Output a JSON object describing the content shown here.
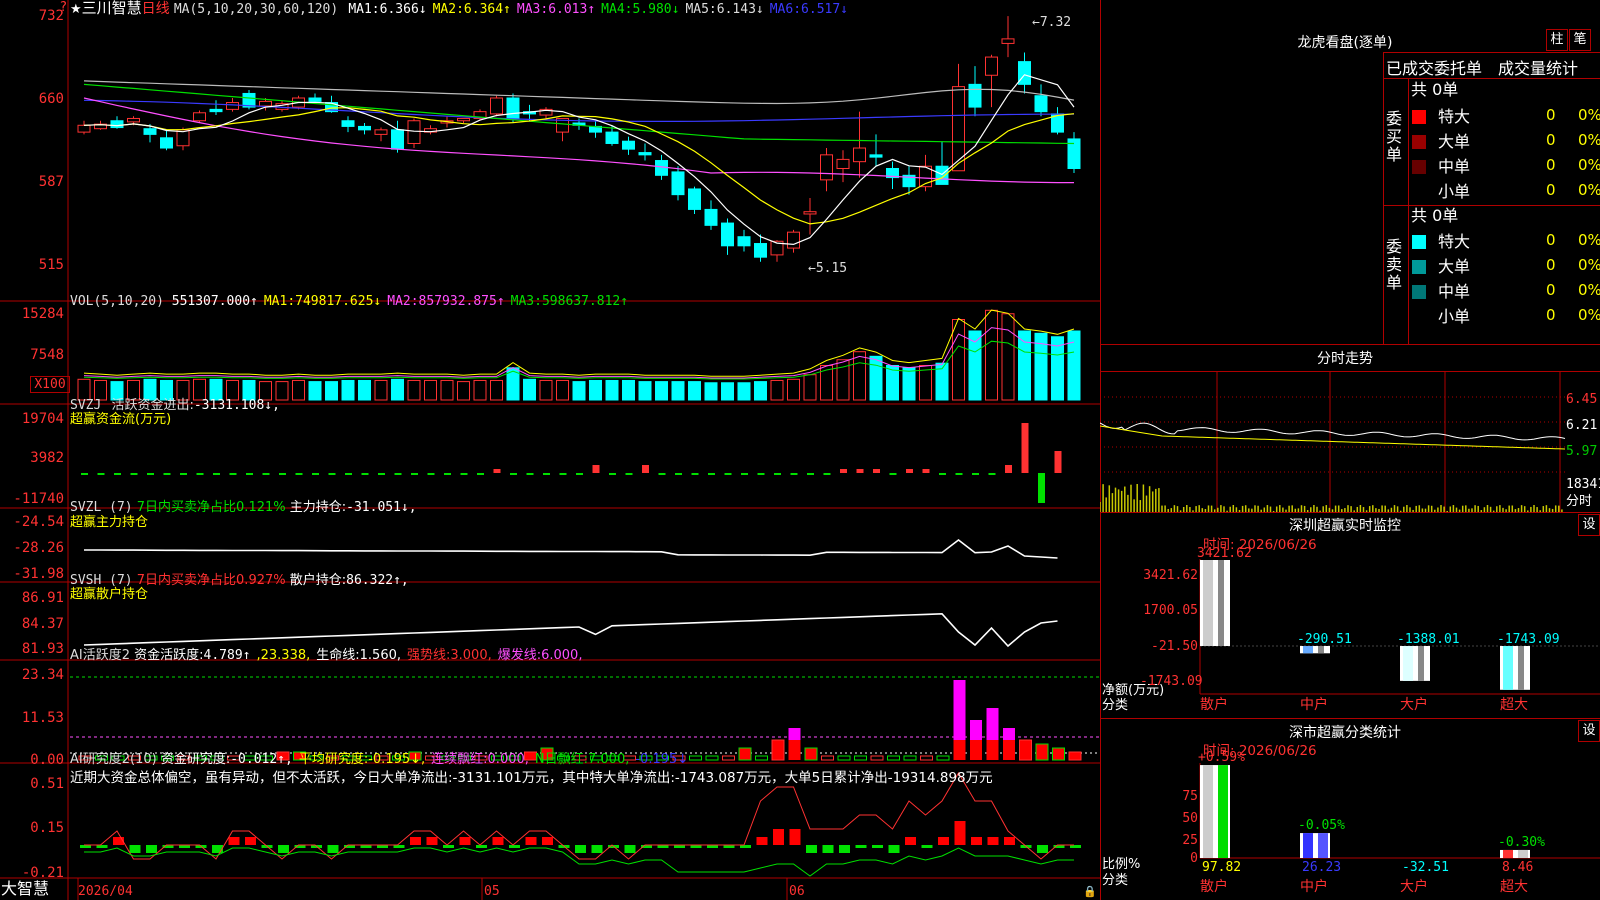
{
  "stock": {
    "name": "三川智慧",
    "period": "日线",
    "qmark": "?",
    "star": "★"
  },
  "main_ma": {
    "label": "MA(5,10,20,30,60,120)",
    "items": [
      {
        "name": "MA1:",
        "value": "6.366↓",
        "color": "#ffffff"
      },
      {
        "name": "MA2:",
        "value": "6.364↑",
        "color": "#ffff00"
      },
      {
        "name": "MA3:",
        "value": "6.013↑",
        "color": "#ff50ff"
      },
      {
        "name": "MA4:",
        "value": "5.980↓",
        "color": "#00e000"
      },
      {
        "name": "MA5:",
        "value": "6.143↓",
        "color": "#dddddd"
      },
      {
        "name": "MA6:",
        "value": "6.517↓",
        "color": "#3a3aff"
      }
    ],
    "y_ticks": [
      "732",
      "660",
      "587",
      "515"
    ],
    "high_label": "7.32",
    "low_label": "5.15"
  },
  "vol": {
    "label": "VOL(5,10,20)",
    "value": "551307.000↑",
    "items": [
      {
        "name": "MA1:",
        "value": "749817.625↓",
        "color": "#ffff00"
      },
      {
        "name": "MA2:",
        "value": "857932.875↑",
        "color": "#ff50ff"
      },
      {
        "name": "MA3:",
        "value": "598637.812↑",
        "color": "#00e000"
      }
    ],
    "y_ticks": [
      "15284",
      "7548"
    ],
    "unit": "X100"
  },
  "svzj": {
    "label": "SVZJ",
    "desc": "活跃资金进出:",
    "value": "-3131.108↓,",
    "sub": "超赢资金流(万元)",
    "y_ticks": [
      "19704",
      "3982",
      "-11740"
    ]
  },
  "svzl": {
    "label": "SVZL (7)",
    "desc": "7日内买卖净占比0.121%",
    "desc2": "主力持仓:",
    "value": "-31.051↓,",
    "sub": "超赢主力持仓",
    "y_ticks": [
      "-24.54",
      "-28.26",
      "-31.98"
    ]
  },
  "svsh": {
    "label": "SVSH (7)",
    "desc": "7日内买卖净占比0.927%",
    "desc2": "散户持仓:",
    "value": "86.322↑,",
    "sub": "超赢散户持仓",
    "y_ticks": [
      "86.91",
      "84.37",
      "81.93"
    ]
  },
  "ai1": {
    "label": "AI活跃度2",
    "desc": "资金活跃度:",
    "value": "4.789↑",
    "items": [
      {
        "text": ",23.338,",
        "color": "#ffff00"
      },
      {
        "text": "生命线:1.560,",
        "color": "#ffffff"
      },
      {
        "text": "强势线:3.000,",
        "color": "#ff3232"
      },
      {
        "text": "爆发线:6.000,",
        "color": "#ff50ff"
      }
    ],
    "y_ticks": [
      "23.34",
      "11.53",
      "0.00"
    ]
  },
  "ai2": {
    "label": "AI研究度2(10)",
    "desc": "资金研究度:",
    "value": "-0.012↑,",
    "items": [
      {
        "text": "平均研究度:-0.195↓,",
        "color": "#ffff00"
      },
      {
        "text": "连续飘红:0.000,",
        "color": "#ff50ff"
      },
      {
        "text": "N日飘红:7.000,",
        "color": "#00e000"
      },
      {
        "text": "-0.195↓",
        "color": "#3a3aff"
      }
    ],
    "note": "近期大资金总体偏空，虽有异动，但不太活跃，今日大单净流出:-3131.101万元，其中特大单净流出:-1743.087万元，大单5日累计净出-19314.898万元",
    "y_ticks": [
      "0.51",
      "0.15",
      "-0.21"
    ]
  },
  "xaxis": {
    "start": "2026/04",
    "m1": "05",
    "m2": "06"
  },
  "brand": "大智慧",
  "right": {
    "lhb": {
      "title": "龙虎看盘(逐单)",
      "btn1": "柱",
      "btn2": "笔"
    },
    "tabs": [
      "已成交",
      "委托单",
      "成交量统计"
    ],
    "buy": {
      "side_label": "委买单",
      "total": "共 0单",
      "rows": [
        {
          "name": "特大",
          "v": "0",
          "p": "0%",
          "color": "#ff0000"
        },
        {
          "name": "大单",
          "v": "0",
          "p": "0%",
          "color": "#990000"
        },
        {
          "name": "中单",
          "v": "0",
          "p": "0%",
          "color": "#660000"
        },
        {
          "name": "小单",
          "v": "0",
          "p": "0%",
          "color": "#000000"
        }
      ]
    },
    "sell": {
      "side_label": "委卖单",
      "total": "共 0单",
      "rows": [
        {
          "name": "特大",
          "v": "0",
          "p": "0%",
          "color": "#00ffff"
        },
        {
          "name": "大单",
          "v": "0",
          "p": "0%",
          "color": "#009999"
        },
        {
          "name": "中单",
          "v": "0",
          "p": "0%",
          "color": "#007777"
        },
        {
          "name": "小单",
          "v": "0",
          "p": "0%",
          "color": "#000000"
        }
      ]
    },
    "intraday": {
      "title": "分时走势",
      "y_ticks": [
        "6.45",
        "6.21",
        "5.97"
      ],
      "vol": "18341",
      "xlabel": "分时"
    },
    "sz_monitor": {
      "title": "深圳超赢实时监控",
      "btn": "设",
      "time": "时间: 2026/06/26",
      "y_ticks": [
        "3421.62",
        "1700.05",
        "-21.50",
        "-1743.09"
      ],
      "bars": [
        {
          "v": "3421.62",
          "c": "散户"
        },
        {
          "v": "-290.51",
          "c": "中户"
        },
        {
          "v": "-1388.01",
          "c": "大户"
        },
        {
          "v": "-1743.09",
          "c": "超大"
        }
      ],
      "ylabel": "净额(万元)",
      "xlabel": "分类"
    },
    "sz_class": {
      "title": "深市超赢分类统计",
      "btn": "设",
      "time": "时间: 2026/06/26",
      "y_ticks": [
        "75",
        "50",
        "25",
        "0"
      ],
      "bars": [
        {
          "top": "+0.59%",
          "v": "97.82",
          "c": "散户"
        },
        {
          "top": "-0.05%",
          "v": "26.23",
          "c": "中户"
        },
        {
          "top": "",
          "v": "-32.51",
          "c": "大户"
        },
        {
          "top": "-0.30%",
          "v": "8.46",
          "c": "超大"
        }
      ],
      "ylabel": "比例%",
      "xlabel": "分类"
    }
  }
}
